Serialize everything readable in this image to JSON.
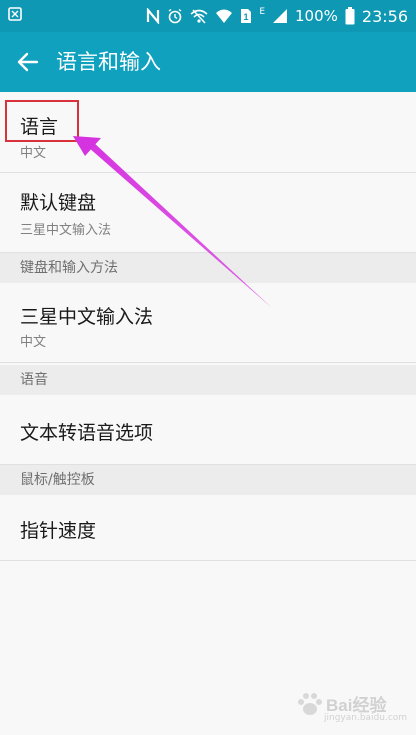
{
  "status_bar": {
    "battery": "100%",
    "time": "23:56",
    "signal_label": "E",
    "sim_label": "1"
  },
  "app_bar": {
    "title": "语言和输入",
    "back_icon": "arrow-left-icon"
  },
  "items": [
    {
      "title": "语言",
      "subtitle": "中文"
    },
    {
      "title": "默认键盘",
      "subtitle": "三星中文输入法"
    }
  ],
  "sections": [
    {
      "header": "键盘和输入方法",
      "items": [
        {
          "title": "三星中文输入法",
          "subtitle": "中文"
        }
      ]
    },
    {
      "header": "语音",
      "items": [
        {
          "title": "文本转语音选项"
        }
      ]
    },
    {
      "header": "鼠标/触控板",
      "items": [
        {
          "title": "指针速度"
        }
      ]
    }
  ],
  "annotation": {
    "highlight_color": "#d8333c",
    "arrow_color": "#d633e0"
  },
  "watermark": {
    "text": "Bai经验",
    "subtext": "jingyan.baidu.com"
  },
  "colors": {
    "status_bar": "#0e98b3",
    "app_bar": "#0fa1be",
    "background": "#f8f8f8",
    "section_header": "#ececec"
  }
}
